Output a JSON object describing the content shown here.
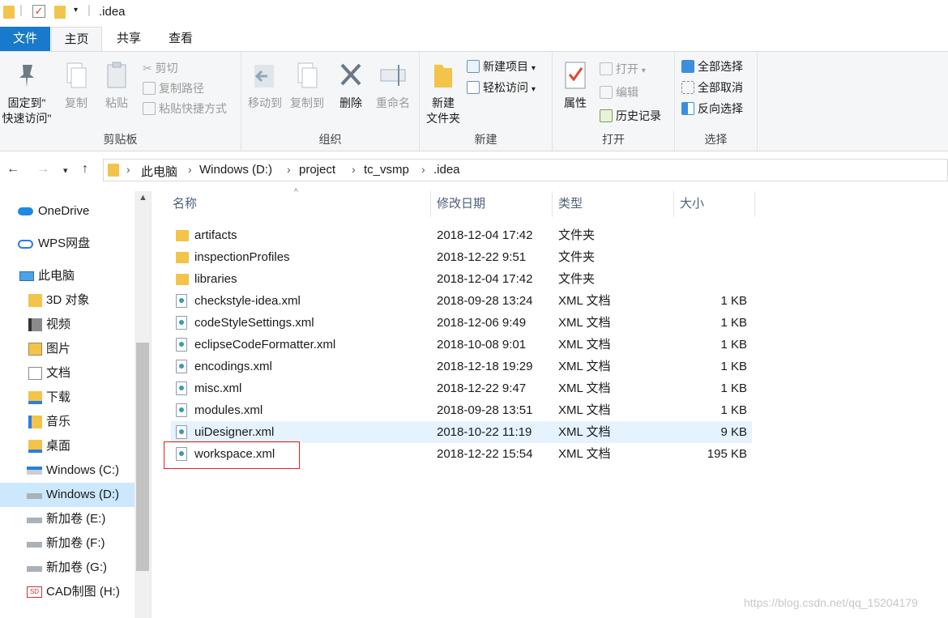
{
  "window": {
    "title": ".idea"
  },
  "tabs": {
    "file": "文件",
    "home": "主页",
    "share": "共享",
    "view": "查看"
  },
  "ribbon": {
    "clipboard": {
      "pin_line1": "固定到\"",
      "pin_line2": "快速访问\"",
      "copy": "复制",
      "paste": "粘贴",
      "cut": "剪切",
      "copy_path": "复制路径",
      "paste_shortcut": "粘贴快捷方式",
      "label": "剪贴板"
    },
    "organize": {
      "move_to": "移动到",
      "copy_to": "复制到",
      "delete": "删除",
      "rename": "重命名",
      "label": "组织"
    },
    "new": {
      "new_folder_line1": "新建",
      "new_folder_line2": "文件夹",
      "new_item": "新建项目",
      "easy_access": "轻松访问",
      "label": "新建"
    },
    "open": {
      "properties": "属性",
      "open": "打开",
      "edit": "编辑",
      "history": "历史记录",
      "label": "打开"
    },
    "select": {
      "select_all": "全部选择",
      "select_none": "全部取消",
      "invert": "反向选择",
      "label": "选择"
    }
  },
  "address": {
    "crumbs": [
      "此电脑",
      "Windows (D:)",
      "project",
      "tc_vsmp",
      ".idea"
    ]
  },
  "nav": {
    "items": [
      {
        "label": "OneDrive",
        "icon": "onedrive-icon"
      },
      {
        "label": "WPS网盘",
        "icon": "cloud-icon"
      },
      {
        "label": "此电脑",
        "icon": "computer-icon"
      },
      {
        "label": "3D 对象",
        "icon": "3d-objects-icon"
      },
      {
        "label": "视频",
        "icon": "video-icon"
      },
      {
        "label": "图片",
        "icon": "pictures-icon"
      },
      {
        "label": "文档",
        "icon": "documents-icon"
      },
      {
        "label": "下载",
        "icon": "download-icon"
      },
      {
        "label": "音乐",
        "icon": "music-icon"
      },
      {
        "label": "桌面",
        "icon": "desktop-icon"
      },
      {
        "label": "Windows (C:)",
        "icon": "drive-icon"
      },
      {
        "label": "Windows (D:)",
        "icon": "drive-icon"
      },
      {
        "label": "新加卷 (E:)",
        "icon": "drive-icon"
      },
      {
        "label": "新加卷 (F:)",
        "icon": "drive-icon"
      },
      {
        "label": "新加卷 (G:)",
        "icon": "drive-icon"
      },
      {
        "label": "CAD制图 (H:)",
        "icon": "drive-icon"
      }
    ],
    "selected": "Windows (D:)"
  },
  "columns": {
    "name": "名称",
    "modified": "修改日期",
    "type": "类型",
    "size": "大小"
  },
  "files": [
    {
      "name": "artifacts",
      "modified": "2018-12-04 17:42",
      "type": "文件夹",
      "size": "",
      "kind": "folder"
    },
    {
      "name": "inspectionProfiles",
      "modified": "2018-12-22 9:51",
      "type": "文件夹",
      "size": "",
      "kind": "folder"
    },
    {
      "name": "libraries",
      "modified": "2018-12-04 17:42",
      "type": "文件夹",
      "size": "",
      "kind": "folder"
    },
    {
      "name": "checkstyle-idea.xml",
      "modified": "2018-09-28 13:24",
      "type": "XML 文档",
      "size": "1 KB",
      "kind": "xml"
    },
    {
      "name": "codeStyleSettings.xml",
      "modified": "2018-12-06 9:49",
      "type": "XML 文档",
      "size": "1 KB",
      "kind": "xml"
    },
    {
      "name": "eclipseCodeFormatter.xml",
      "modified": "2018-10-08 9:01",
      "type": "XML 文档",
      "size": "1 KB",
      "kind": "xml"
    },
    {
      "name": "encodings.xml",
      "modified": "2018-12-18 19:29",
      "type": "XML 文档",
      "size": "1 KB",
      "kind": "xml"
    },
    {
      "name": "misc.xml",
      "modified": "2018-12-22 9:47",
      "type": "XML 文档",
      "size": "1 KB",
      "kind": "xml"
    },
    {
      "name": "modules.xml",
      "modified": "2018-09-28 13:51",
      "type": "XML 文档",
      "size": "1 KB",
      "kind": "xml"
    },
    {
      "name": "uiDesigner.xml",
      "modified": "2018-10-22 11:19",
      "type": "XML 文档",
      "size": "9 KB",
      "kind": "xml"
    },
    {
      "name": "workspace.xml",
      "modified": "2018-12-22 15:54",
      "type": "XML 文档",
      "size": "195 KB",
      "kind": "xml"
    }
  ],
  "hovered_file": "uiDesigner.xml",
  "highlighted_file": "workspace.xml",
  "watermark": "https://blog.csdn.net/qq_15204179",
  "colors": {
    "accent": "#1979ca",
    "selection": "#cce8ff",
    "hover": "#e5f3ff",
    "highlight_box": "#e02020"
  }
}
